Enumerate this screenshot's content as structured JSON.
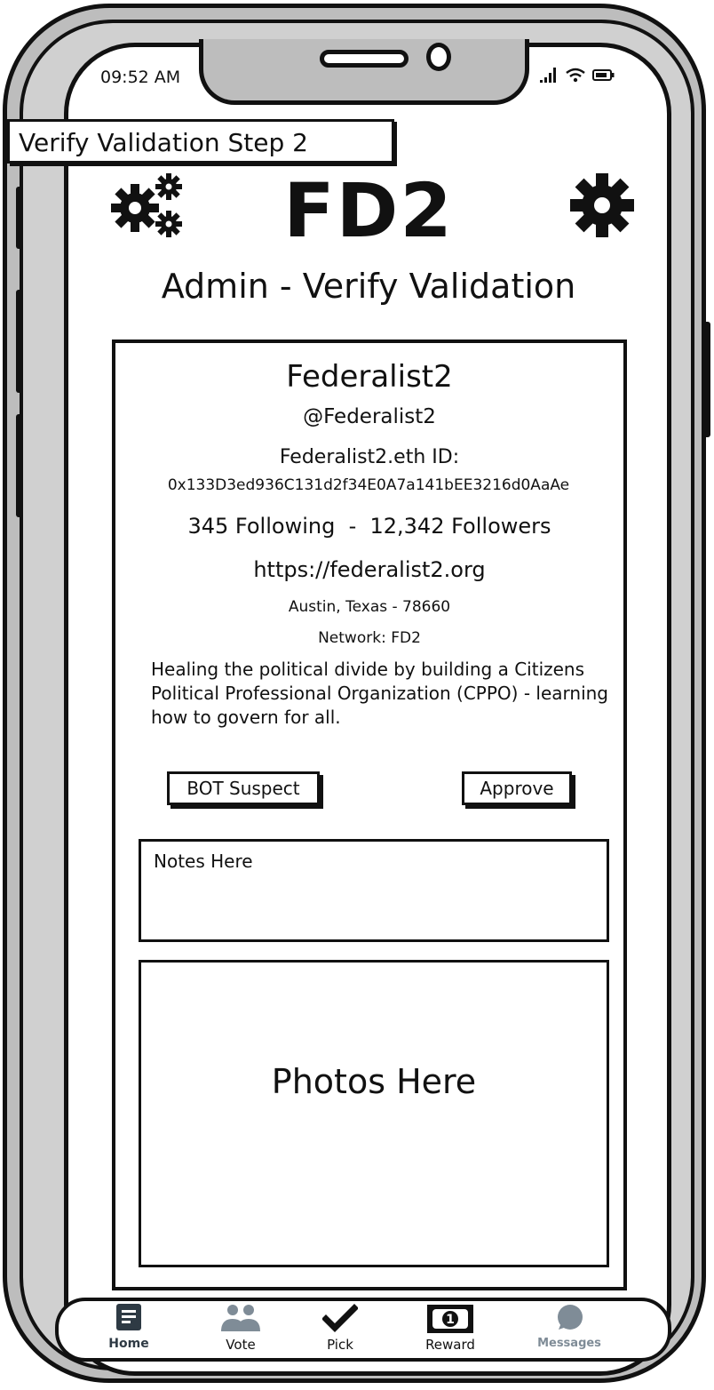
{
  "status_bar": {
    "time": "09:52 AM",
    "icons": "..ıl ᯤ ▭"
  },
  "step_label": "Verify Validation Step 2",
  "header": {
    "brand": "FD2",
    "title": "Admin - Verify Validation",
    "left_icon": "gears-icon",
    "right_icon": "gear-icon"
  },
  "profile": {
    "name": "Federalist2",
    "handle": "@Federalist2",
    "eth_label": "Federalist2.eth ID:",
    "eth_address": "0x133D3ed936C131d2f34E0A7a141bEE3216d0AaAe",
    "follow_stats": "345 Following  -  12,342 Followers",
    "website": "https://federalist2.org",
    "location": "Austin, Texas - 78660",
    "network": "Network: FD2",
    "bio": "Healing the political divide by building a Citizens Political Professional Organization (CPPO) - learning how to govern for all."
  },
  "actions": {
    "bot_suspect": "BOT Suspect",
    "approve": "Approve"
  },
  "notes": {
    "placeholder": "Notes Here"
  },
  "photos": {
    "placeholder": "Photos Here"
  },
  "tabs": [
    {
      "label": "Home",
      "icon": "home-icon"
    },
    {
      "label": "Vote",
      "icon": "people-icon"
    },
    {
      "label": "Pick",
      "icon": "checkmark-icon"
    },
    {
      "label": "Reward",
      "icon": "money-icon"
    },
    {
      "label": "Messages",
      "icon": "chat-bubble-icon"
    }
  ],
  "colors": {
    "ink": "#111111",
    "frame": "#bdbdbd",
    "tab_gray": "#7f8c97",
    "home_icon": "#2e3a44"
  }
}
